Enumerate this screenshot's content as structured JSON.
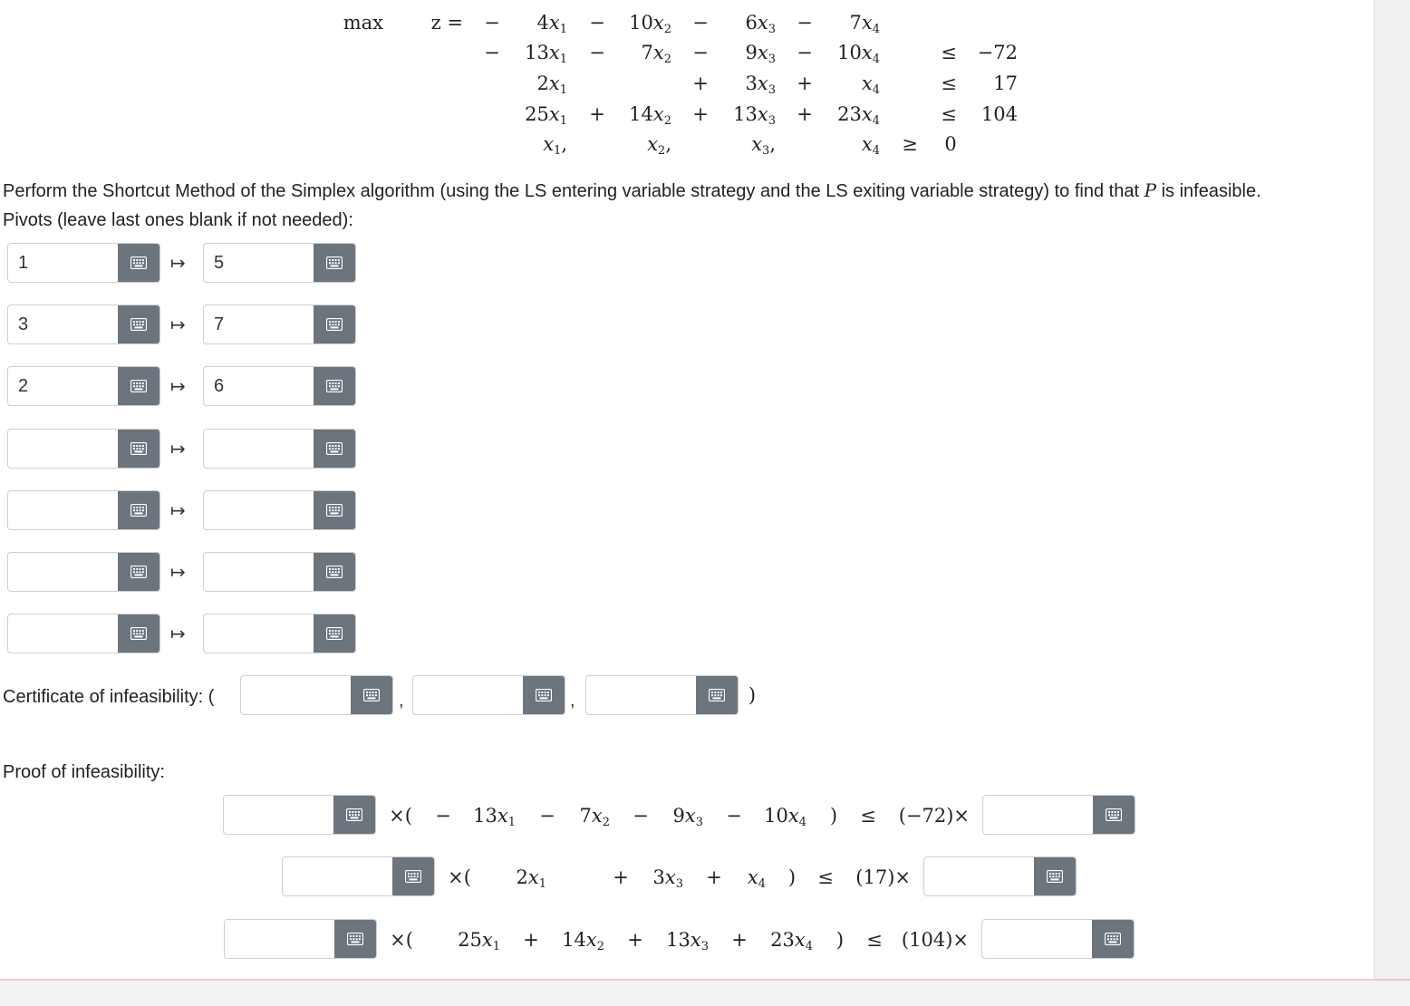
{
  "lp": {
    "max_label": "max",
    "z_label": "z =",
    "objective": [
      "−",
      "4x1",
      "−",
      "10x2",
      "−",
      "6x3",
      "−",
      "7x4"
    ],
    "constraints": [
      {
        "sign0": "−",
        "t1": "13x1",
        "s1": "−",
        "t2": "7x2",
        "s2": "−",
        "t3": "9x3",
        "s3": "−",
        "t4": "10x4",
        "rel": "≤",
        "rhs": "−72"
      },
      {
        "sign0": "",
        "t1": "2x1",
        "s1": "",
        "t2": "",
        "s2": "+",
        "t3": "3x3",
        "s3": "+",
        "t4": "x4",
        "rel": "≤",
        "rhs": "17"
      },
      {
        "sign0": "",
        "t1": "25x1",
        "s1": "+",
        "t2": "14x2",
        "s2": "+",
        "t3": "13x3",
        "s3": "+",
        "t4": "23x4",
        "rel": "≤",
        "rhs": "104"
      }
    ],
    "nonneg": {
      "v1": "x1,",
      "v2": "x2,",
      "v3": "x3,",
      "v4": "x4",
      "rel": "≥",
      "rhs": "0"
    }
  },
  "instructions": {
    "line1_before": "Perform the Shortcut Method of the Simplex algorithm (using the LS entering variable strategy and the LS exiting variable strategy) to find that ",
    "var": "P",
    "line1_after": " is infeasible.",
    "line2": "Pivots (leave last ones blank if not needed):"
  },
  "pivots": [
    {
      "enter": "1",
      "exit": "5"
    },
    {
      "enter": "3",
      "exit": "7"
    },
    {
      "enter": "2",
      "exit": "6"
    },
    {
      "enter": "",
      "exit": ""
    },
    {
      "enter": "",
      "exit": ""
    },
    {
      "enter": "",
      "exit": ""
    },
    {
      "enter": "",
      "exit": ""
    }
  ],
  "arrow_glyph": "↦",
  "certificate": {
    "label": "Certificate of infeasibility: (",
    "comma": ",",
    "close": ")",
    "values": [
      "",
      "",
      ""
    ]
  },
  "proof": {
    "label": "Proof of infeasibility:",
    "open": "×(",
    "close": ")",
    "rows": [
      {
        "multiplier": "",
        "terms": [
          "−",
          "13x1",
          "−",
          "7x2",
          "−",
          "9x3",
          "−",
          "10x4"
        ],
        "rel": "≤",
        "rhs": "(−72)×",
        "rhs_multiplier": ""
      },
      {
        "multiplier": "",
        "terms": [
          "2x1",
          "+",
          "3x3",
          "+",
          "x4"
        ],
        "rel": "≤",
        "rhs": "(17)×",
        "rhs_multiplier": ""
      },
      {
        "multiplier": "",
        "terms": [
          "25x1",
          "+",
          "14x2",
          "+",
          "13x3",
          "+",
          "23x4"
        ],
        "rel": "≤",
        "rhs": "(104)×",
        "rhs_multiplier": ""
      }
    ]
  },
  "icons": {
    "keyboard": "keyboard-icon"
  },
  "colors": {
    "keypad_button": "#6c757d",
    "field_border": "#cfcfcf",
    "text": "#222222"
  }
}
